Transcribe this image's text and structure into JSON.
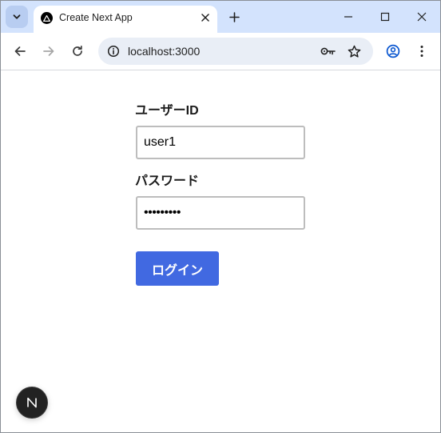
{
  "browser": {
    "tab": {
      "title": "Create Next App",
      "favicon": "nextjs-logo-icon"
    },
    "address_bar": {
      "url": "localhost:3000"
    },
    "icons": {
      "tab_search": "chevron-down-icon",
      "tab_close": "close-icon",
      "new_tab": "plus-icon",
      "minimize": "minimize-icon",
      "maximize": "maximize-icon",
      "close_window": "close-icon",
      "back": "arrow-left-icon",
      "forward": "arrow-right-icon",
      "reload": "reload-icon",
      "site_info": "info-icon",
      "password_manager": "key-icon",
      "bookmark": "star-icon",
      "profile": "profile-icon",
      "menu": "more-vertical-icon"
    },
    "colors": {
      "tabstrip": "#d3e3fd",
      "omnibox": "#e9eef6"
    }
  },
  "login_form": {
    "user_id_label": "ユーザーID",
    "user_id_value": "user1",
    "password_label": "パスワード",
    "password_value": "•••••••••",
    "submit_label": "ログイン"
  },
  "colors": {
    "button_bg": "#4169e1",
    "button_text": "#ffffff",
    "input_border": "#bdbdbd"
  },
  "dev_indicator": {
    "letter": "N",
    "icon": "nextjs-dev-indicator-icon"
  }
}
